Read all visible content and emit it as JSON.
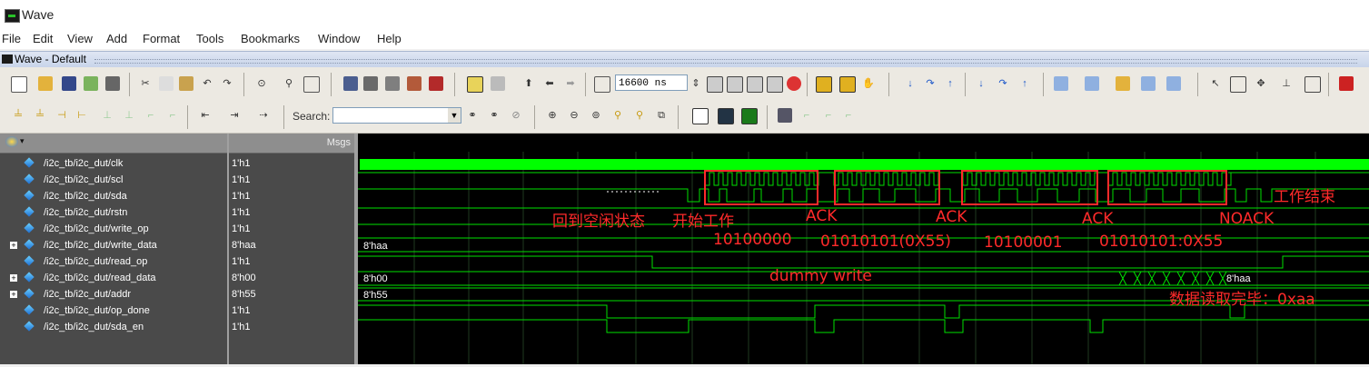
{
  "window": {
    "title": "Wave",
    "subwindow_title": "Wave - Default"
  },
  "menu": [
    "File",
    "Edit",
    "View",
    "Add",
    "Format",
    "Tools",
    "Bookmarks",
    "Window",
    "Help"
  ],
  "toolbar": {
    "time_value": "16600 ns",
    "search_label": "Search:",
    "search_value": ""
  },
  "panes": {
    "msgs_header": "Msgs"
  },
  "signals": [
    {
      "name": "/i2c_tb/i2c_dut/clk",
      "value": "1'h1",
      "expandable": false
    },
    {
      "name": "/i2c_tb/i2c_dut/scl",
      "value": "1'h1",
      "expandable": false
    },
    {
      "name": "/i2c_tb/i2c_dut/sda",
      "value": "1'h1",
      "expandable": false
    },
    {
      "name": "/i2c_tb/i2c_dut/rstn",
      "value": "1'h1",
      "expandable": false
    },
    {
      "name": "/i2c_tb/i2c_dut/write_op",
      "value": "1'h1",
      "expandable": false
    },
    {
      "name": "/i2c_tb/i2c_dut/write_data",
      "value": "8'haa",
      "expandable": true
    },
    {
      "name": "/i2c_tb/i2c_dut/read_op",
      "value": "1'h1",
      "expandable": false
    },
    {
      "name": "/i2c_tb/i2c_dut/read_data",
      "value": "8'h00",
      "expandable": true
    },
    {
      "name": "/i2c_tb/i2c_dut/addr",
      "value": "8'h55",
      "expandable": true
    },
    {
      "name": "/i2c_tb/i2c_dut/op_done",
      "value": "1'h1",
      "expandable": false
    },
    {
      "name": "/i2c_tb/i2c_dut/sda_en",
      "value": "1'h1",
      "expandable": false
    }
  ],
  "wave_labels": {
    "write_data": "8'haa",
    "read_data_start": "8'h00",
    "read_data_end": "8'haa",
    "addr": "8'h55"
  },
  "annotations": {
    "idle": "回到空闲状态",
    "start": "开始工作",
    "ack1": "ACK",
    "ack2": "ACK",
    "ack3": "ACK",
    "noack": "NOACK",
    "end": "工作结束",
    "byte1": "10100000",
    "byte2": "01010101(0X55)",
    "byte3": "10100001",
    "byte4": "01010101:0X55",
    "dummy": "dummy write",
    "read_done": "数据读取完毕：0xaa"
  },
  "colors": {
    "wave": "#00e000",
    "annotation": "#ff2a2a",
    "background": "#000000",
    "clk_bar": "#00ff00"
  }
}
